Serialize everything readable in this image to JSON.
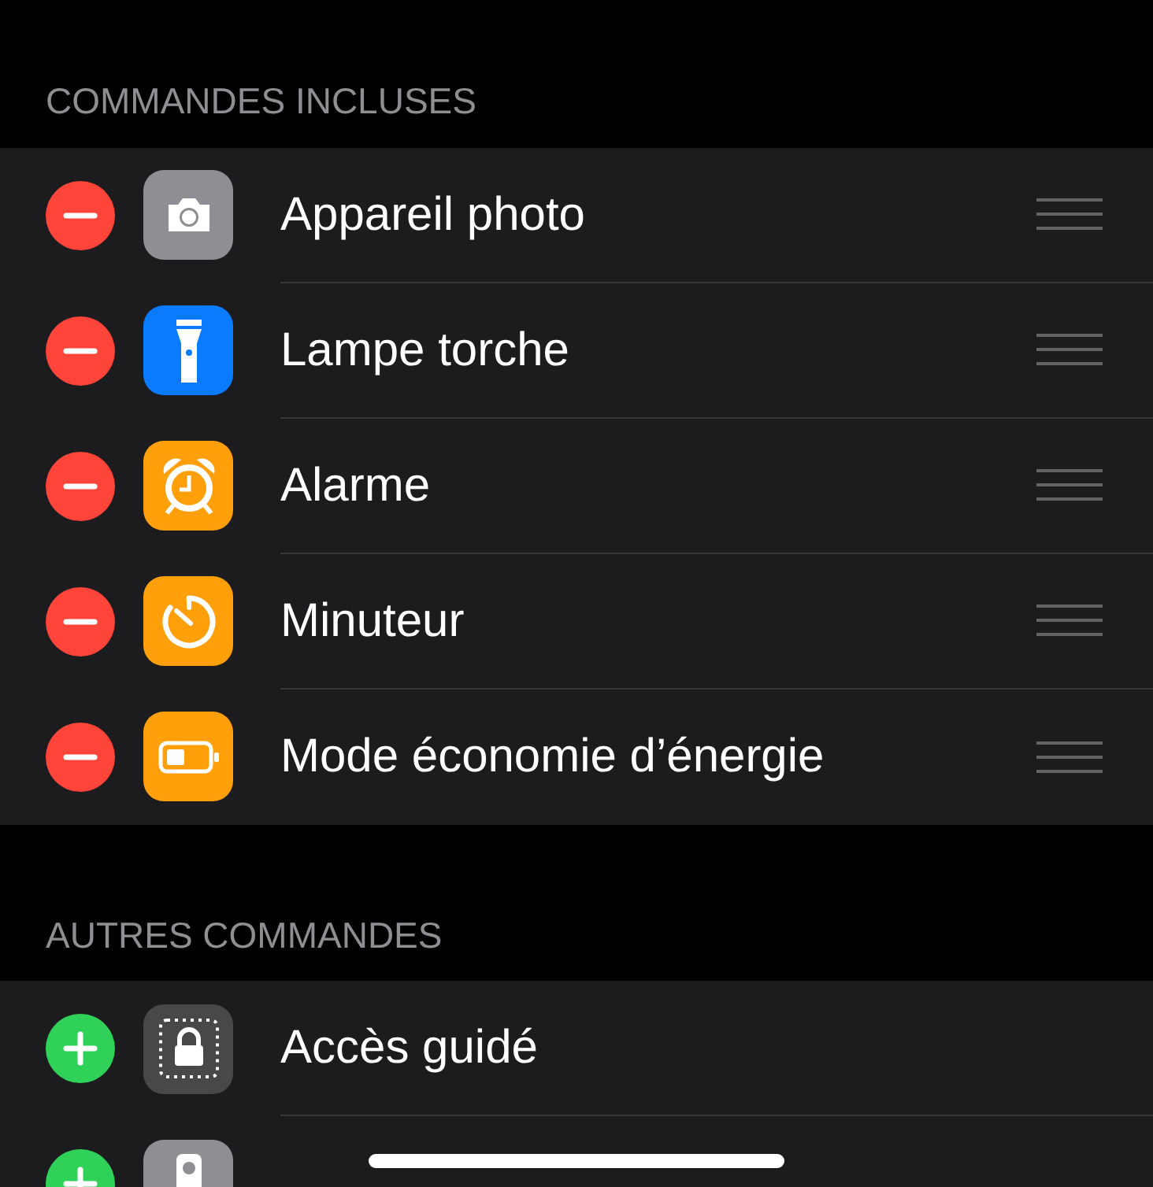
{
  "sections": [
    {
      "header": "COMMANDES INCLUSES",
      "rows": [
        {
          "included": true,
          "kind": "camera",
          "color": "#8e8e93",
          "label": "Appareil photo",
          "reorder": true
        },
        {
          "included": true,
          "kind": "flashlight",
          "color": "#0a7aff",
          "label": "Lampe torche",
          "reorder": true
        },
        {
          "included": true,
          "kind": "alarm",
          "color": "#ff9f0a",
          "label": "Alarme",
          "reorder": true
        },
        {
          "included": true,
          "kind": "timer",
          "color": "#ff9f0a",
          "label": "Minuteur",
          "reorder": true
        },
        {
          "included": true,
          "kind": "battery",
          "color": "#ff9f0a",
          "label": "Mode économie d’énergie",
          "reorder": true
        }
      ]
    },
    {
      "header": "AUTRES COMMANDES",
      "rows": [
        {
          "included": false,
          "kind": "lock",
          "color": "#48484a",
          "label": "Accès guidé",
          "reorder": false
        },
        {
          "included": false,
          "kind": "remote",
          "color": "#8e8e93",
          "reorder": false
        }
      ]
    }
  ]
}
